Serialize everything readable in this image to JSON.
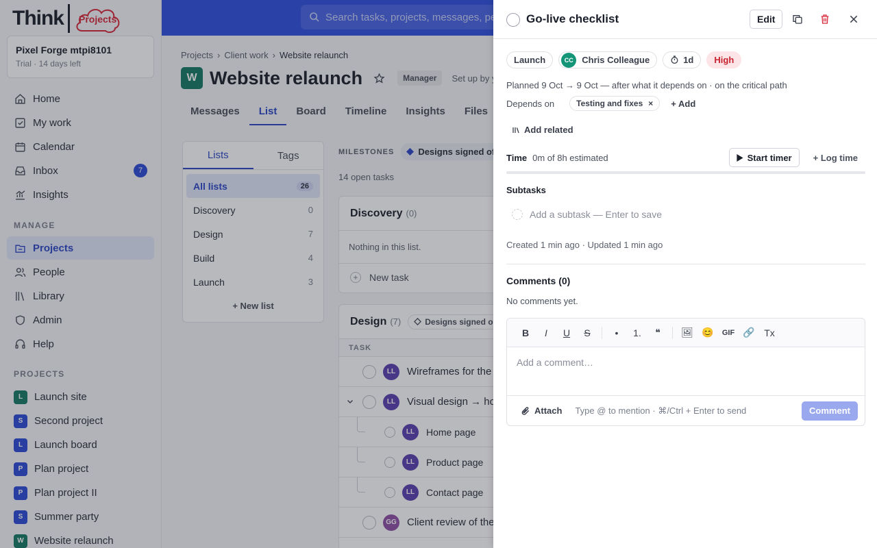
{
  "logo": {
    "think": "Think",
    "projects": "Projects"
  },
  "workspace": {
    "name": "Pixel Forge mtpi8101",
    "plan": "Trial",
    "days_left": "· 14 days left"
  },
  "nav": {
    "home": "Home",
    "my_work": "My work",
    "calendar": "Calendar",
    "inbox": "Inbox",
    "inbox_count": "7",
    "insights": "Insights",
    "manage_label": "MANAGE",
    "projects": "Projects",
    "people": "People",
    "library": "Library",
    "admin": "Admin",
    "help": "Help",
    "projects_label": "PROJECTS"
  },
  "sidebar_projects": [
    {
      "initial": "L",
      "name": "Launch site",
      "color": "#147a64"
    },
    {
      "initial": "S",
      "name": "Second project",
      "color": "#2c4bd6"
    },
    {
      "initial": "L",
      "name": "Launch board",
      "color": "#2c4bd6"
    },
    {
      "initial": "P",
      "name": "Plan project",
      "color": "#2c4bd6"
    },
    {
      "initial": "P",
      "name": "Plan project II",
      "color": "#2c4bd6"
    },
    {
      "initial": "S",
      "name": "Summer party",
      "color": "#2c4bd6"
    },
    {
      "initial": "W",
      "name": "Website relaunch",
      "color": "#147a64"
    }
  ],
  "search": {
    "placeholder": "Search tasks, projects, messages, people…"
  },
  "breadcrumb": {
    "a": "Projects",
    "b": "Client work",
    "c": "Website relaunch",
    "sep": "›"
  },
  "project": {
    "initial": "W",
    "title": "Website relaunch",
    "role": "Manager",
    "setup": "Set up by you"
  },
  "tabs": [
    "Messages",
    "List",
    "Board",
    "Timeline",
    "Insights",
    "Files"
  ],
  "lists_panel": {
    "tab_lists": "Lists",
    "tab_tags": "Tags",
    "rows": [
      {
        "name": "All lists",
        "count": "26"
      },
      {
        "name": "Discovery",
        "count": "0"
      },
      {
        "name": "Design",
        "count": "7"
      },
      {
        "name": "Build",
        "count": "4"
      },
      {
        "name": "Launch",
        "count": "3"
      }
    ],
    "new_list": "+ New list"
  },
  "milestones": {
    "label": "MILESTONES",
    "chip": "Designs signed off"
  },
  "open_tasks": "14 open tasks",
  "discovery": {
    "title": "Discovery",
    "count": "(0)",
    "empty": "Nothing in this list.",
    "new_task": "New task"
  },
  "design": {
    "title": "Design",
    "count": "(7)",
    "milestone": "Designs signed off",
    "col_task": "TASK",
    "tasks": [
      {
        "initials": "LL",
        "title": "Wireframes for the key pages"
      },
      {
        "initials": "LL",
        "title": "Visual design → homepage"
      },
      {
        "initials": "LL",
        "title": "Home page"
      },
      {
        "initials": "LL",
        "title": "Product page"
      },
      {
        "initials": "LL",
        "title": "Contact page"
      },
      {
        "initials": "GG",
        "title": "Client review of the designs"
      }
    ]
  },
  "drawer": {
    "title": "Go-live checklist",
    "edit": "Edit",
    "list_chip": "Launch",
    "assignee_initials": "CC",
    "assignee": "Chris Colleague",
    "duration": "1d",
    "priority": "High",
    "planned": "Planned 9 Oct → 9 Oct — after what it depends on · on the critical path",
    "depends_label": "Depends on",
    "depends_chip": "Testing and fixes",
    "depends_remove": "×",
    "add_dep": "+ Add",
    "add_related": "Add related",
    "time_label": "Time",
    "time_value": "0m of 8h estimated",
    "time_progress": 0,
    "start_timer": "Start timer",
    "log_time": "+ Log time",
    "subtasks_label": "Subtasks",
    "subtask_placeholder": "Add a subtask — Enter to save",
    "created": "Created 1 min ago · Updated 1 min ago",
    "comments_label": "Comments (0)",
    "no_comments": "No comments yet.",
    "toolbar": {
      "bold": "B",
      "italic": "I",
      "underline": "U",
      "strike": "S",
      "bullet": "•",
      "ordered": "1.",
      "quote": "❝",
      "image": "🖼",
      "emoji": "😊",
      "gif": "GIF",
      "link": "🔗",
      "clear": "Tx"
    },
    "comment_placeholder": "Add a comment…",
    "attach": "Attach",
    "hint": "Type @ to mention · ⌘/Ctrl + Enter to send",
    "comment_btn": "Comment"
  },
  "colors": {
    "brand": "#2f4fe0",
    "accent": "#2b47c8",
    "priority_high": "#c8222f"
  }
}
